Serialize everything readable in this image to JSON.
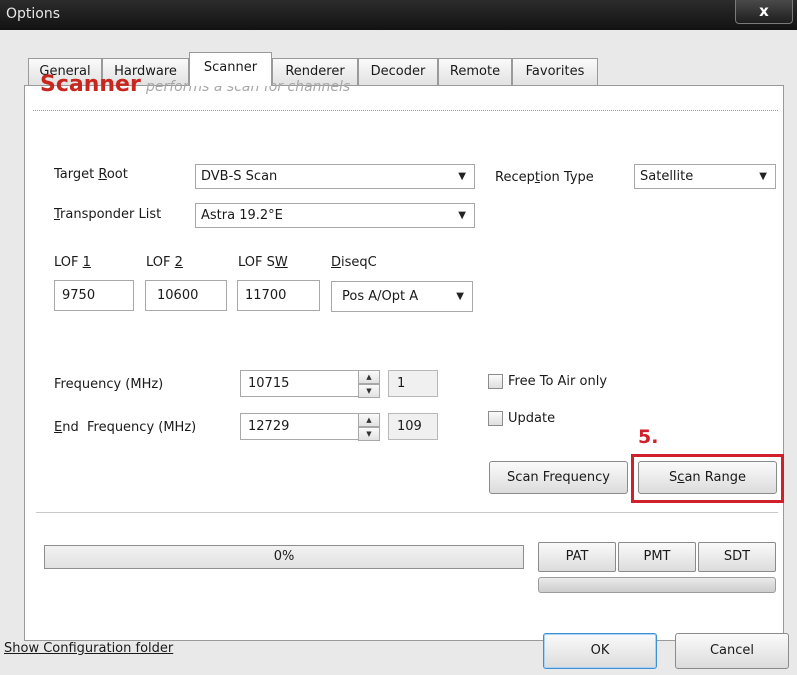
{
  "window": {
    "title": "Options",
    "close_label": "x"
  },
  "tabs": [
    {
      "label": "General",
      "active": false
    },
    {
      "label": "Hardware",
      "active": false
    },
    {
      "label": "Scanner",
      "active": true
    },
    {
      "label": "Renderer",
      "active": false
    },
    {
      "label": "Decoder",
      "active": false
    },
    {
      "label": "Remote",
      "active": false
    },
    {
      "label": "Favorites",
      "active": false
    }
  ],
  "scanner": {
    "heading": "Scanner",
    "subheading": "performs a scan for channels",
    "target_root": {
      "label_pre": "Target ",
      "label_key": "R",
      "label_post": "oot",
      "value": "DVB-S Scan"
    },
    "transponder_list": {
      "label_key": "T",
      "label_post": "ransponder List",
      "value": "Astra 19.2°E"
    },
    "reception_type": {
      "label_pre": "Recep",
      "label_key": "t",
      "label_post": "ion Type",
      "value": "Satellite"
    },
    "lof1": {
      "label_pre": "LOF ",
      "label_key": "1",
      "value": "9750"
    },
    "lof2": {
      "label_pre": "LOF ",
      "label_key": "2",
      "value": "10600"
    },
    "lofsw": {
      "label_pre": "LOF S",
      "label_key": "W",
      "value": "11700"
    },
    "diseqc": {
      "label_key": "D",
      "label_post": "iseqC",
      "value": "Pos A/Opt A"
    },
    "frequency": {
      "label": "Frequency (MHz)",
      "value": "10715",
      "index": "1"
    },
    "end_frequency": {
      "label_key": "E",
      "label_post": "nd  Frequency (MHz)",
      "value": "12729",
      "index": "109"
    },
    "free_to_air": {
      "label": "Free To Air only",
      "checked": false
    },
    "update": {
      "label": "Update",
      "checked": false
    },
    "annotation": "5.",
    "scan_frequency_label": "Scan Frequency",
    "scan_range": {
      "label_pre": "S",
      "label_key": "c",
      "label_post": "an Range"
    },
    "progress": {
      "text": "0%",
      "value": 0
    },
    "pat_label": "PAT",
    "pmt_label": "PMT",
    "sdt_label": "SDT"
  },
  "footer": {
    "config_link": "Show Configuration folder",
    "ok_label": "OK",
    "cancel_label": "Cancel"
  },
  "colors": {
    "accent": "#c7271e",
    "highlight_box": "#d0202c",
    "ok_border": "#3d8fd6"
  }
}
